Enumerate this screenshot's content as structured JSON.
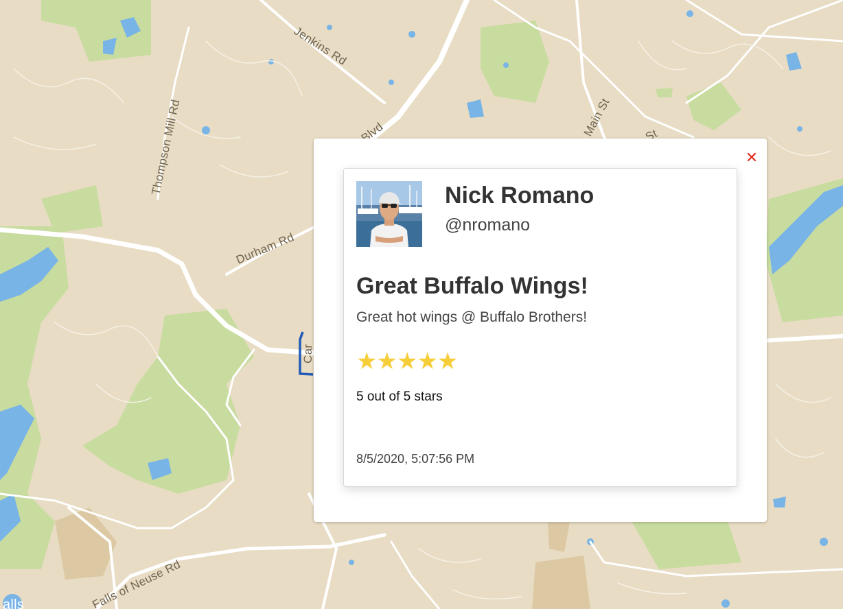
{
  "map": {
    "road_labels": {
      "jenkins": "Jenkins Rd",
      "thompson": "Thompson Mill Rd",
      "durham": "Durham Rd",
      "blvd": "Blvd",
      "main": "Main St",
      "st": "St",
      "neuse": "Falls of Neuse Rd",
      "car": "Car",
      "falls": "alls"
    },
    "colors": {
      "land": "#e8dcc4",
      "park": "#c8dca0",
      "water": "#78b4e6",
      "road": "#ffffff"
    }
  },
  "popup": {
    "close_label": "✕",
    "author": {
      "name": "Nick Romano",
      "handle": "@nromano"
    },
    "post": {
      "title": "Great Buffalo Wings!",
      "text": "Great hot wings @ Buffalo Brothers!",
      "stars": "★★★★★",
      "rating": 5,
      "rating_max": 5,
      "rating_text": "5 out of 5 stars",
      "timestamp": "8/5/2020, 5:07:56 PM"
    },
    "colors": {
      "close": "#e02a1d",
      "star": "#f5ce3a"
    }
  }
}
